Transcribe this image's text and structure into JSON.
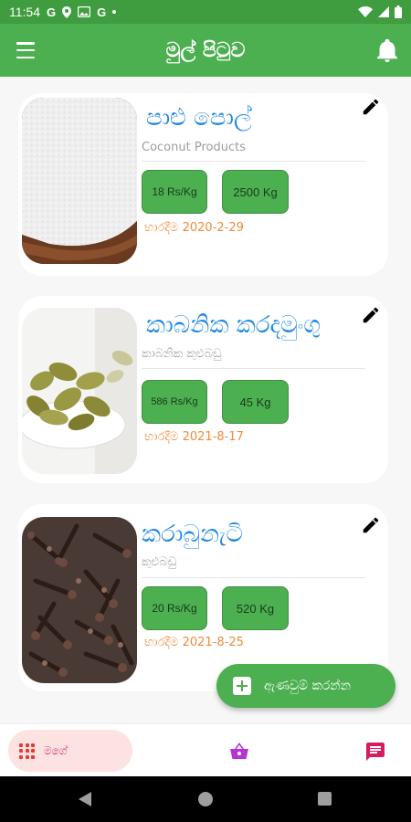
{
  "status_bar": {
    "time": "11:54",
    "icons": [
      "google-g-icon",
      "location-pin-icon",
      "photo-icon",
      "google-g-icon",
      "dot-icon"
    ],
    "right_icons": [
      "wifi-icon",
      "signal-icon",
      "battery-icon"
    ]
  },
  "header": {
    "title": "මුල් පිටුව",
    "menu_icon": "hamburger-menu-icon",
    "notification_icon": "bell-icon"
  },
  "products": [
    {
      "title": "පාළු පොල්",
      "subtitle": "Coconut Products",
      "price": "18 Rs/Kg",
      "quantity": "2500 Kg",
      "date": "භාරදීම 2020-2-29",
      "image": "desiccated-coconut-photo"
    },
    {
      "title": "කාබනික කරදමුංගු",
      "subtitle": "කාබනික කුළුබඩු",
      "price": "586 Rs/Kg",
      "quantity": "45 Kg",
      "date": "භාරදීම 2021-8-17",
      "image": "cardamom-photo"
    },
    {
      "title": "කරාබුනැටි",
      "subtitle": "කුළුබඩු",
      "price": "20 Rs/Kg",
      "quantity": "520 Kg",
      "date": "භාරදීම 2021-8-25",
      "image": "cloves-photo"
    }
  ],
  "fab": {
    "label": "ඇණවුම් කරන්න",
    "icon": "add-box-icon"
  },
  "bottom_nav": {
    "home_label": "මගේ",
    "home_icon": "apps-grid-icon",
    "basket_icon": "basket-icon",
    "message_icon": "message-icon"
  },
  "colors": {
    "primary": "#4caf50",
    "status_bar": "#3f9c3f",
    "title_blue": "#1e88e5",
    "date_orange": "#ef8a3a",
    "nav_accent": "#d81b60"
  }
}
